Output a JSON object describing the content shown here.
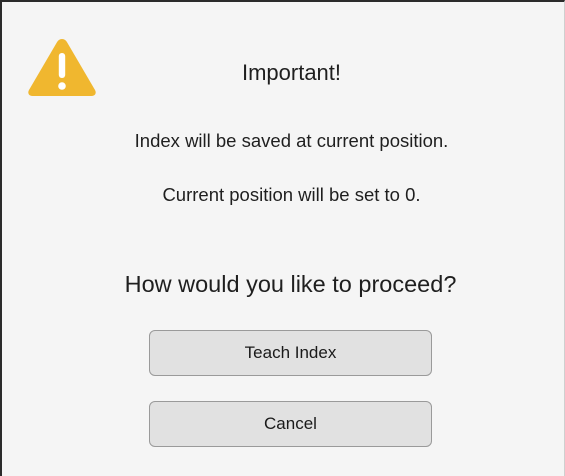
{
  "dialog": {
    "icon": "warning-icon",
    "icon_color": "#f0b72f",
    "title": "Important!",
    "messages": [
      "Index will be saved at current position.",
      "Current position will be set to 0."
    ],
    "question": "How would you like to proceed?",
    "buttons": {
      "teach_label": "Teach Index",
      "cancel_label": "Cancel"
    }
  }
}
